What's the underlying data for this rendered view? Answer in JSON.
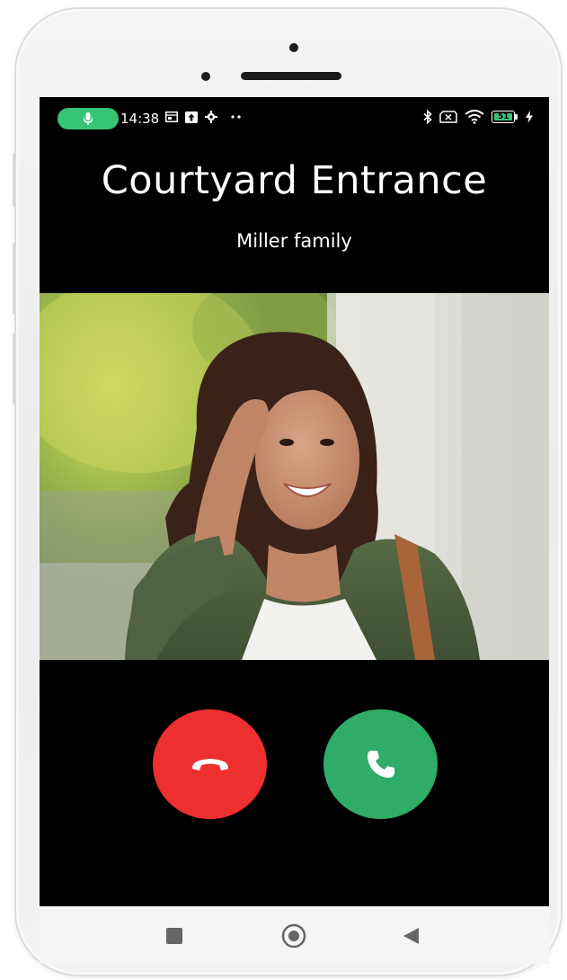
{
  "status_bar": {
    "time": "14:38",
    "mic_indicator_color": "#37c476",
    "left_icons": [
      "screenshot-icon",
      "upload-icon",
      "settings-icon",
      "more-dots-icon"
    ],
    "right_icons": [
      "bluetooth-icon",
      "no-sim-icon",
      "wifi-icon",
      "battery-icon",
      "charging-icon"
    ],
    "battery_level": "51"
  },
  "call": {
    "title": "Courtyard Entrance",
    "subtitle": "Miller family"
  },
  "actions": {
    "decline_color": "#ee2f2f",
    "accept_color": "#2fac68"
  },
  "navigation": {
    "items": [
      "recent-apps-icon",
      "home-icon",
      "back-icon"
    ]
  }
}
